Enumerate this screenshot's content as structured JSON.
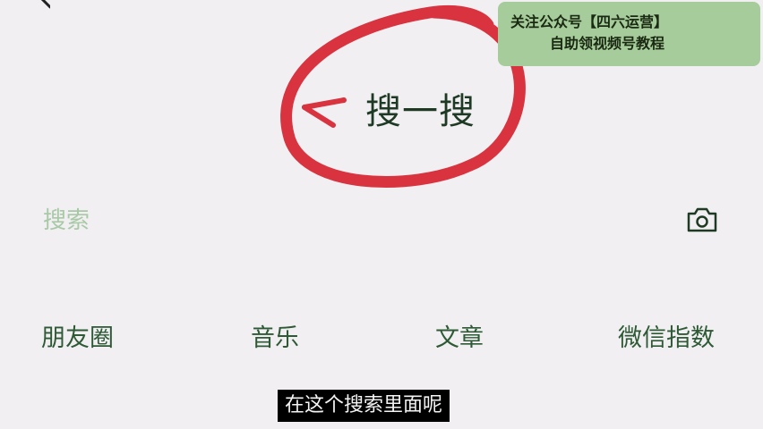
{
  "header": {
    "back_icon": "back-arrow-icon",
    "title": "搜一搜"
  },
  "promo_banner": {
    "line1": "关注公众号【四六运营】",
    "line2": "自助领视频号教程",
    "background": "#a7cc9b"
  },
  "search": {
    "placeholder": "搜索",
    "value": "",
    "camera_icon": "camera-icon"
  },
  "categories": [
    {
      "label": "朋友圈"
    },
    {
      "label": "音乐"
    },
    {
      "label": "文章"
    },
    {
      "label": "微信指数"
    }
  ],
  "subtitle": "在这个搜索里面呢",
  "colors": {
    "background": "#f1eff2",
    "accent_green": "#2d5a35",
    "placeholder_green": "#a8c9a6",
    "annotation_red": "#d8333f"
  }
}
